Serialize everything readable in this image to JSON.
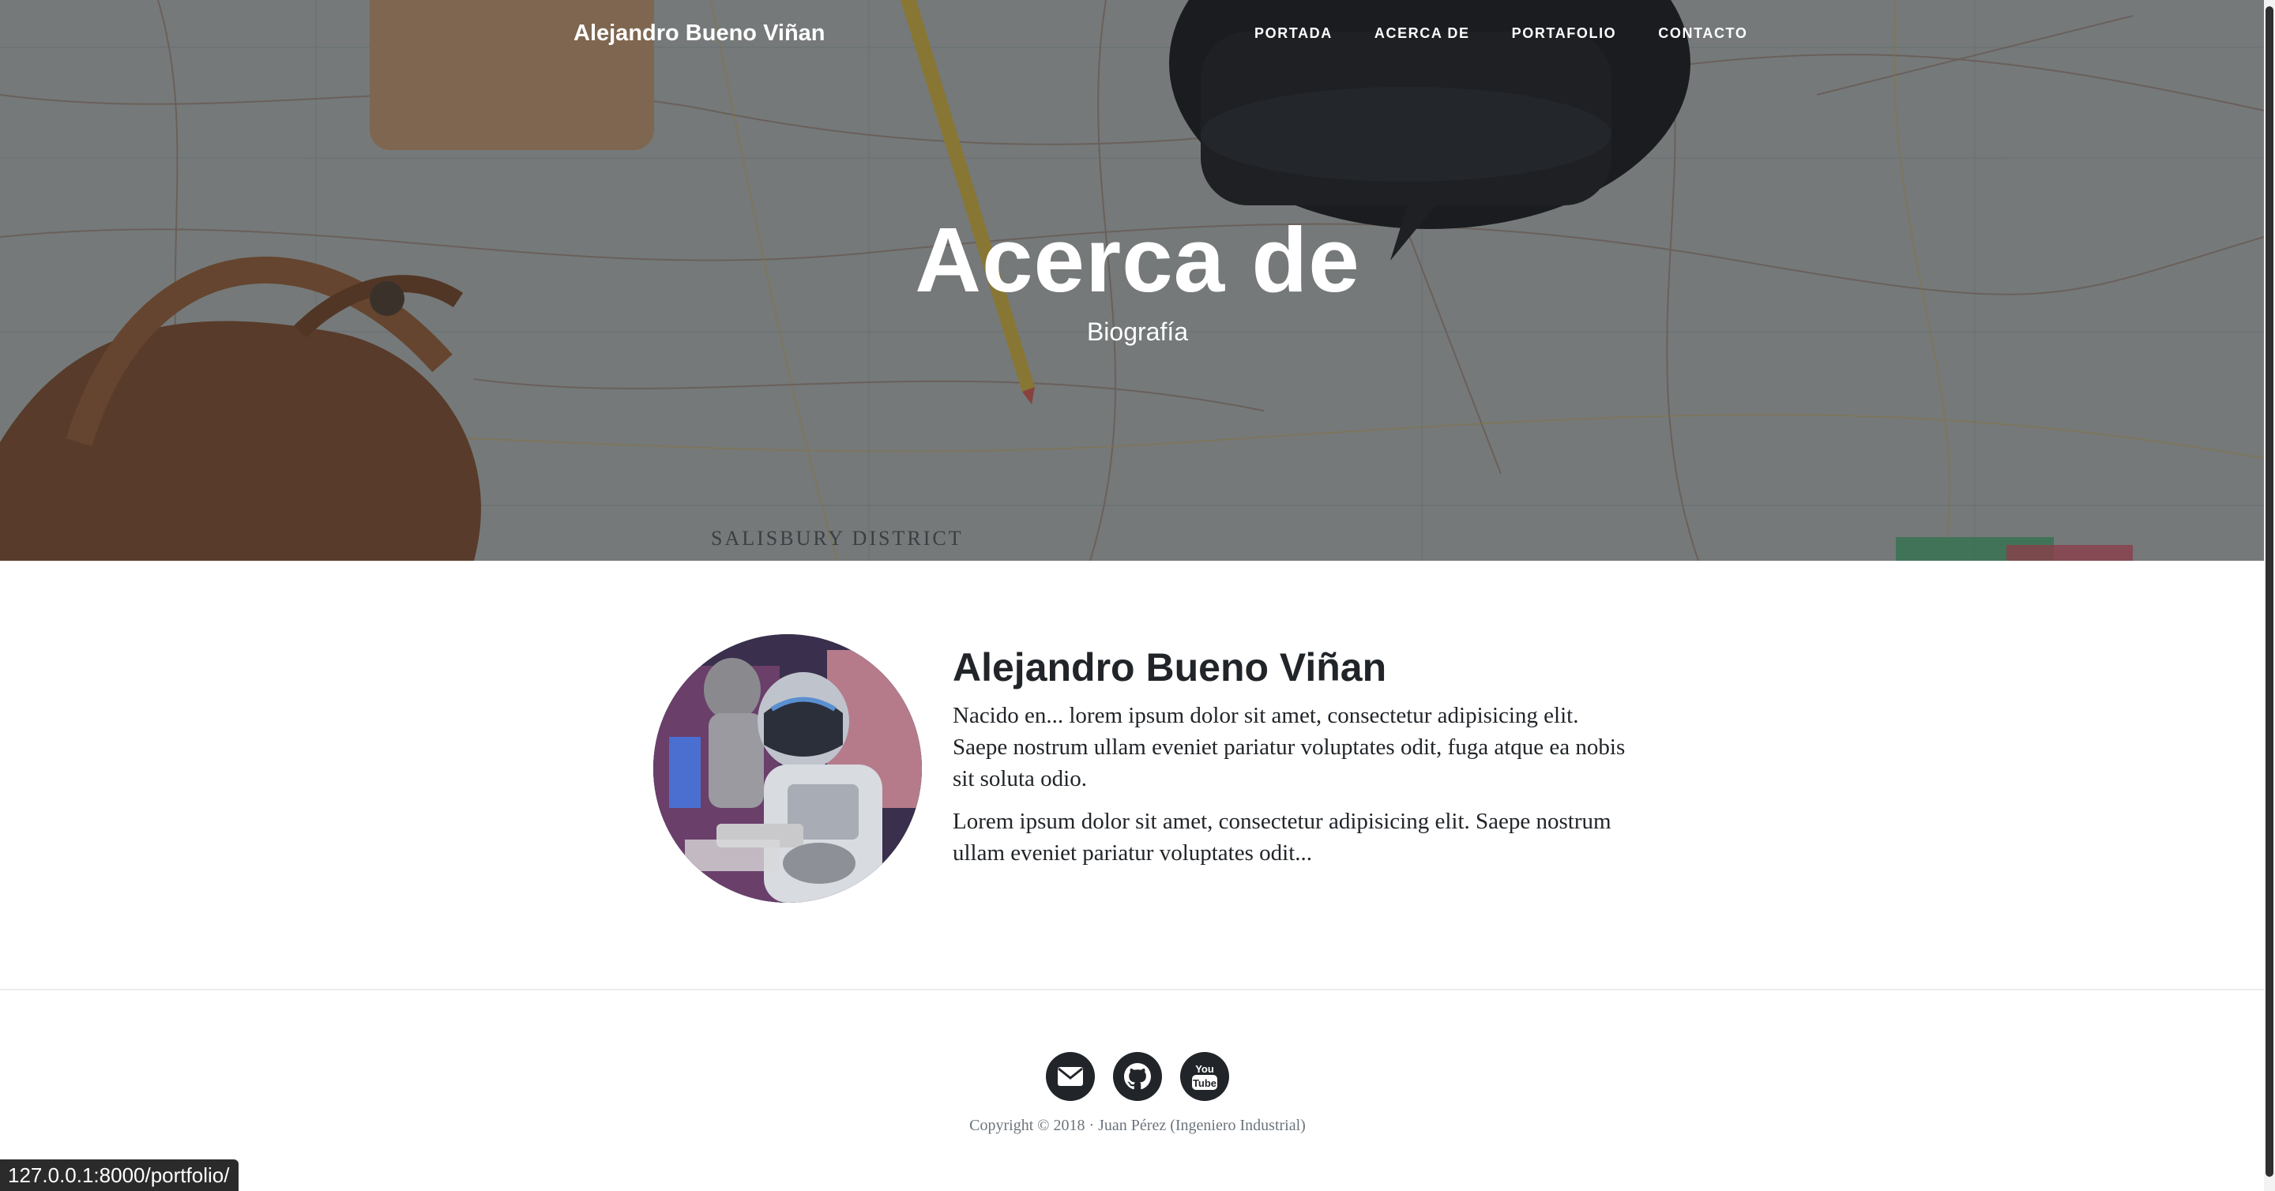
{
  "navbar": {
    "brand": "Alejandro Bueno Viñan",
    "links": [
      "Portada",
      "Acerca de",
      "Portafolio",
      "Contacto"
    ]
  },
  "hero": {
    "title": "Acerca de",
    "subtitle": "Biografía",
    "map_label": "SALISBURY DISTRICT"
  },
  "about": {
    "name": "Alejandro Bueno Viñan",
    "paragraph1": "Nacido en... lorem ipsum dolor sit amet, consectetur adipisicing elit. Saepe nostrum ullam eveniet pariatur voluptates odit, fuga atque ea nobis sit soluta odio.",
    "paragraph2": "Lorem ipsum dolor sit amet, consectetur adipisicing elit. Saepe nostrum ullam eveniet pariatur voluptates odit..."
  },
  "footer": {
    "social": [
      "envelope-icon",
      "github-icon",
      "youtube-icon"
    ],
    "youtube_text_top": "You",
    "youtube_text_bottom": "Tube",
    "copyright": "Copyright © 2018 · Juan Pérez (Ingeniero Industrial)"
  },
  "status_bar": {
    "url": "127.0.0.1:8000/portfolio/"
  },
  "colors": {
    "footer_icon_bg": "#212529",
    "text_dark": "#212529",
    "muted": "#6c757d"
  }
}
